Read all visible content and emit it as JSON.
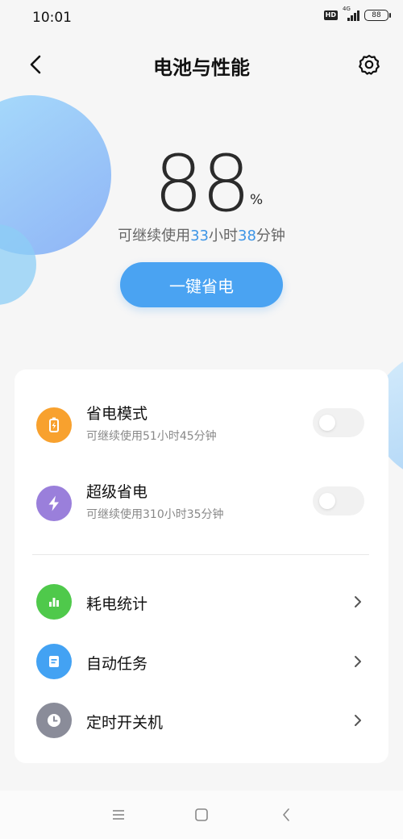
{
  "status_bar": {
    "time": "10:01",
    "hd": "HD",
    "network": "4G",
    "battery_level": "88"
  },
  "header": {
    "title": "电池与性能",
    "back_icon": "chevron-left-icon",
    "settings_icon": "gear-icon"
  },
  "battery": {
    "percent": "88",
    "percent_sign": "%",
    "remaining_prefix": "可继续使用",
    "remaining_hours": "33",
    "hours_unit": "小时",
    "remaining_minutes": "38",
    "minutes_unit": "分钟",
    "one_key_button": "一键省电"
  },
  "modes": [
    {
      "title": "省电模式",
      "subtitle": "可继续使用51小时45分钟",
      "icon": "battery-icon",
      "icon_color": "#f8a12e",
      "enabled": false
    },
    {
      "title": "超级省电",
      "subtitle": "可继续使用310小时35分钟",
      "icon": "lightning-icon",
      "icon_color": "#9a7fdb",
      "enabled": false
    }
  ],
  "links": [
    {
      "title": "耗电统计",
      "icon": "bar-chart-icon",
      "icon_color": "#4fc94b"
    },
    {
      "title": "自动任务",
      "icon": "document-icon",
      "icon_color": "#43a2f3"
    },
    {
      "title": "定时开关机",
      "icon": "clock-icon",
      "icon_color": "#8a8c99"
    }
  ],
  "nav": {
    "menu_icon": "menu-icon",
    "home_icon": "home-square-icon",
    "back_icon": "back-arrow-icon"
  },
  "colors": {
    "accent": "#4aa3f2",
    "highlight_text": "#3d95e6"
  }
}
